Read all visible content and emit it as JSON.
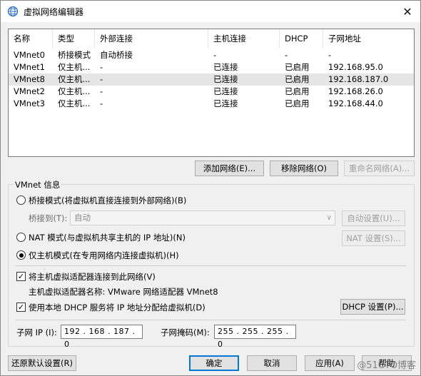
{
  "window": {
    "title": "虚拟网络编辑器",
    "close_glyph": "✕"
  },
  "network_list": {
    "headers": [
      "名称",
      "类型",
      "外部连接",
      "主机连接",
      "DHCP",
      "子网地址"
    ],
    "rows": [
      [
        "VMnet0",
        "桥接模式",
        "自动桥接",
        "-",
        "-",
        "-"
      ],
      [
        "VMnet1",
        "仅主机...",
        "-",
        "已连接",
        "已启用",
        "192.168.95.0"
      ],
      [
        "VMnet8",
        "仅主机...",
        "-",
        "已连接",
        "已启用",
        "192.168.187.0"
      ],
      [
        "VMnet2",
        "仅主机...",
        "-",
        "已连接",
        "已启用",
        "192.168.26.0"
      ],
      [
        "VMnet3",
        "仅主机...",
        "-",
        "已连接",
        "已启用",
        "192.168.44.0"
      ]
    ],
    "selected_index": 2
  },
  "list_buttons": {
    "add": "添加网络(E)...",
    "remove": "移除网络(O)",
    "rename": "重命名网络(A)..."
  },
  "vmnet_info": {
    "group_label": "VMnet 信息",
    "bridge_mode": "桥接模式(将虚拟机直接连接到外部网络)(B)",
    "bridge_to_label": "桥接到(T):",
    "bridge_to_value": "自动",
    "auto_settings": "自动设置(U)...",
    "nat_mode": "NAT 模式(与虚拟机共享主机的 IP 地址)(N)",
    "nat_settings": "NAT 设置(S)...",
    "host_only_mode": "仅主机模式(在专用网络内连接虚拟机)(H)",
    "selected_mode": "host_only",
    "connect_adapter": "将主机虚拟适配器连接到此网络(V)",
    "connect_adapter_checked": true,
    "adapter_name": "主机虚拟适配器名称: VMware 网络适配器 VMnet8",
    "use_dhcp": "使用本地 DHCP 服务将 IP 地址分配给虚拟机(D)",
    "use_dhcp_checked": true,
    "dhcp_settings": "DHCP 设置(P)...",
    "subnet_ip_label": "子网 IP (I):",
    "subnet_ip": "192 . 168 . 187 . 0",
    "subnet_mask_label": "子网掩码(M):",
    "subnet_mask": "255 . 255 . 255 . 0"
  },
  "footer": {
    "restore_defaults": "还原默认设置(R)",
    "ok": "确定",
    "cancel": "取消",
    "apply": "应用(A)",
    "help": "帮助"
  },
  "watermark": "@51CTO博客",
  "colors": {
    "selected_row": "#e5e5e5",
    "primary_border": "#0078d7",
    "app_icon": "#2a6fc9"
  }
}
